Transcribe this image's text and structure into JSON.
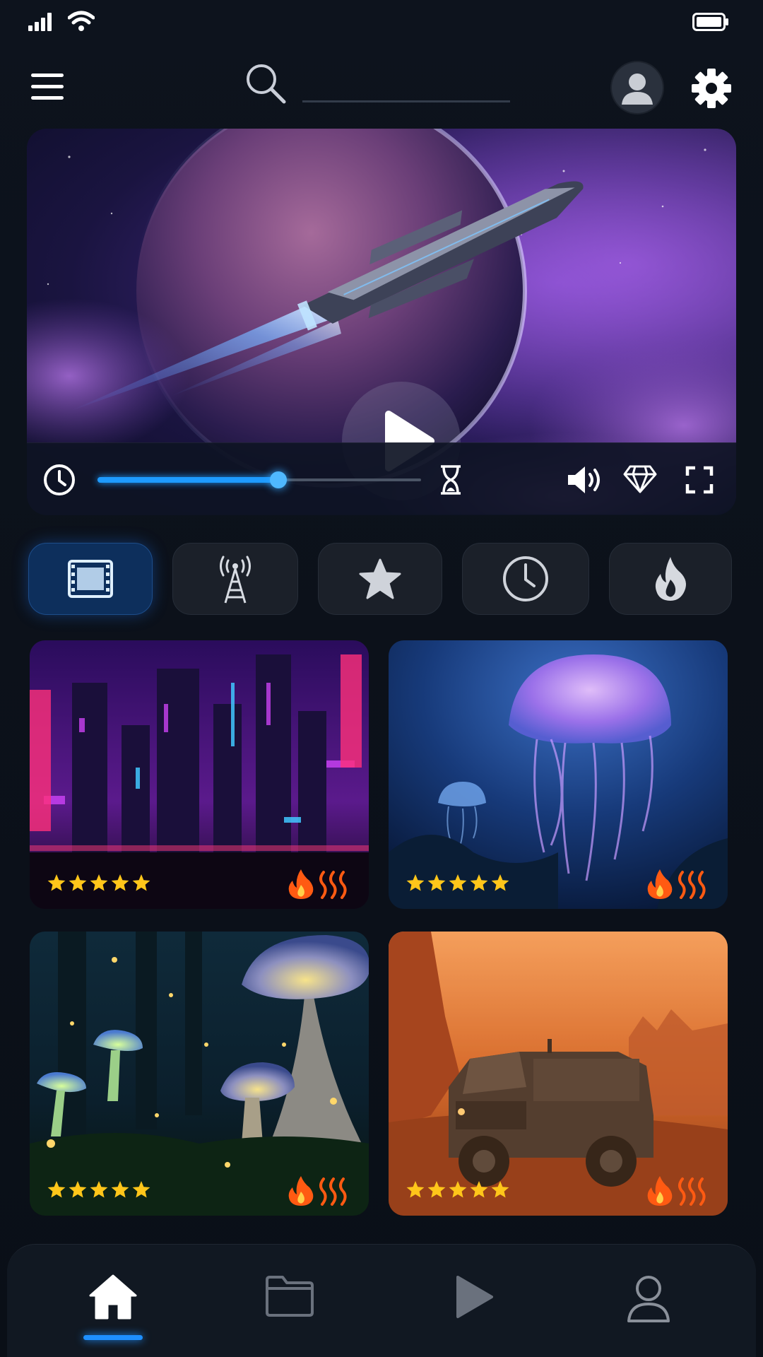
{
  "status_bar": {
    "signal_icon": "signal-bars-icon",
    "wifi_icon": "wifi-icon",
    "battery_icon": "battery-icon"
  },
  "header": {
    "menu_icon": "hamburger-menu-icon",
    "search": {
      "icon": "search-icon",
      "value": "",
      "placeholder": ""
    },
    "avatar_icon": "user-avatar-icon",
    "settings_icon": "gear-icon"
  },
  "hero": {
    "image": "spaceship-passing-planet",
    "play_icon": "play-icon",
    "controls": {
      "clock_icon": "clock-icon",
      "progress": 0.56,
      "hourglass_icon": "hourglass-icon",
      "volume_icon": "volume-icon",
      "diamond_icon": "diamond-icon",
      "fullscreen_icon": "fullscreen-icon"
    }
  },
  "categories": [
    {
      "icon": "film-icon",
      "active": true
    },
    {
      "icon": "broadcast-tower-icon",
      "active": false
    },
    {
      "icon": "star-icon",
      "active": false
    },
    {
      "icon": "clock-icon",
      "active": false
    },
    {
      "icon": "flame-icon",
      "active": false
    }
  ],
  "cards": [
    {
      "image": "neon-city",
      "rating": 5,
      "badge_icon": "flame-heat-icon"
    },
    {
      "image": "jellyfish",
      "rating": 5,
      "badge_icon": "flame-heat-icon"
    },
    {
      "image": "glowing-mushroom-forest",
      "rating": 5,
      "badge_icon": "flame-heat-icon"
    },
    {
      "image": "desert-armored-truck",
      "rating": 5,
      "badge_icon": "flame-heat-icon"
    }
  ],
  "bottom_nav": [
    {
      "icon": "home-icon",
      "active": true
    },
    {
      "icon": "folder-icon",
      "active": false
    },
    {
      "icon": "play-icon",
      "active": false
    },
    {
      "icon": "user-icon",
      "active": false
    }
  ],
  "colors": {
    "background": "#0b1019",
    "accent": "#1e9bff",
    "active_pill": "#0d2f5c",
    "star": "#ffc61a",
    "flame": "#ff5a12"
  }
}
